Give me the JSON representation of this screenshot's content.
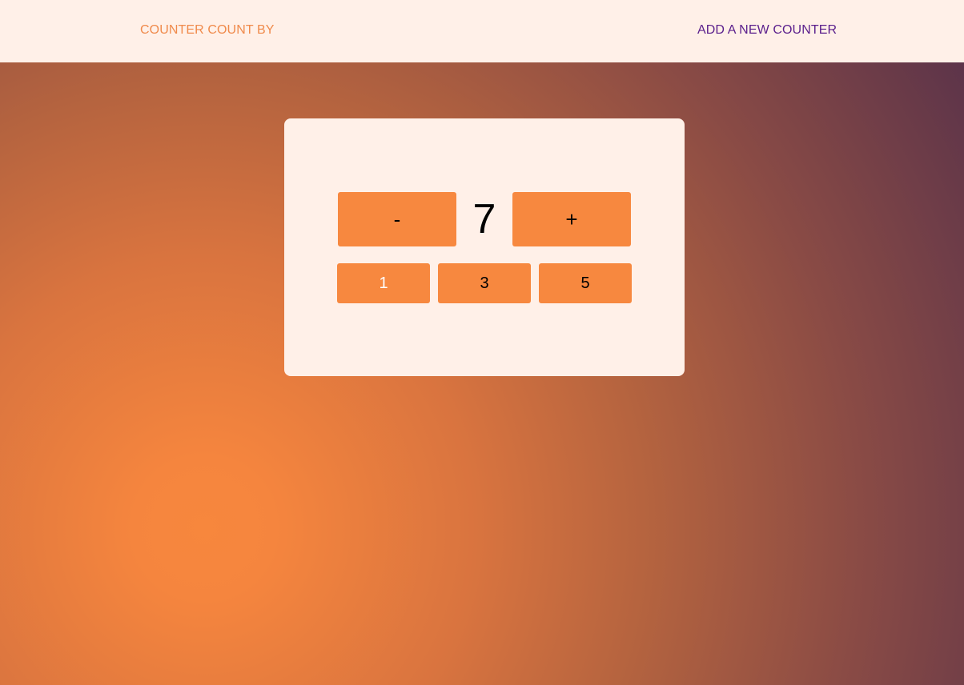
{
  "nav": {
    "left_link": "COUNTER COUNT BY",
    "right_link": "ADD A NEW COUNTER"
  },
  "counter": {
    "decrement_label": "-",
    "value": "7",
    "increment_label": "+",
    "step_options": [
      "1",
      "3",
      "5"
    ],
    "selected_step": "1"
  },
  "colors": {
    "accent": "#f7883f",
    "header_bg": "#fff0e8",
    "left_link_color": "#f08a4b",
    "right_link_color": "#5a1e8c"
  }
}
